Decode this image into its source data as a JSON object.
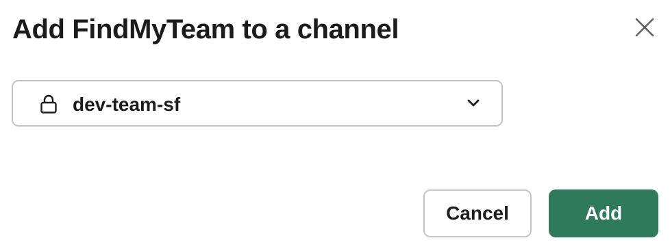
{
  "dialog": {
    "title": "Add FindMyTeam to a channel",
    "close_icon": "close-icon"
  },
  "channel_select": {
    "icon": "lock-icon",
    "selected_value": "dev-team-sf",
    "dropdown_icon": "chevron-down-icon"
  },
  "footer": {
    "cancel_label": "Cancel",
    "add_label": "Add"
  },
  "colors": {
    "primary_button": "#2f7a5b",
    "text": "#1d1c1d",
    "border": "#c4c4c4"
  }
}
